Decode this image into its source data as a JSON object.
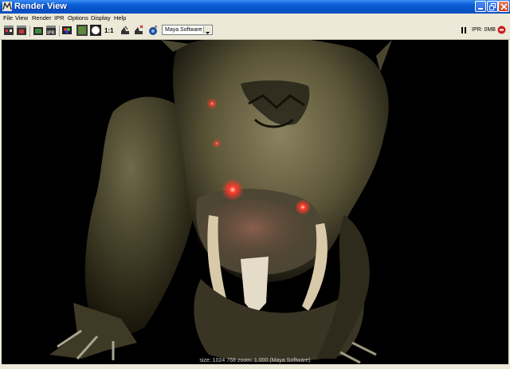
{
  "window": {
    "title": "Render View",
    "controls": [
      "minimize-icon",
      "maximize-icon",
      "close-icon"
    ]
  },
  "menu": [
    "File",
    "View",
    "Render",
    "IPR",
    "Options",
    "Display",
    "Help"
  ],
  "toolbar": {
    "ratio_label": "1:1",
    "renderer": "Maya Software",
    "ipr_status": "IPR: 0MB"
  },
  "viewport": {
    "status": "size: 1024  768 zoom: 1.000  (Maya Software)"
  },
  "colors": {
    "titlebar": "#0a5fd8",
    "chrome": "#ece9d8",
    "render_bg": "#000000",
    "glow": "#ff3a2a"
  }
}
